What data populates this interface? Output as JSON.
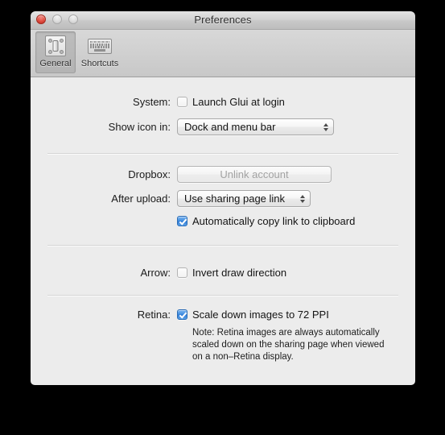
{
  "window": {
    "title": "Preferences",
    "traffic_lights": [
      "close-button",
      "minimize-button",
      "zoom-button"
    ]
  },
  "toolbar": {
    "items": [
      {
        "label": "General",
        "icon": "light-switch-icon",
        "selected": true
      },
      {
        "label": "Shortcuts",
        "icon": "keyboard-icon",
        "selected": false
      }
    ]
  },
  "sections": {
    "system": {
      "label": "System:",
      "launch_at_login": {
        "text": "Launch Glui at login",
        "checked": false
      },
      "show_icon_in": {
        "label": "Show icon in:",
        "value": "Dock and menu bar"
      }
    },
    "dropbox": {
      "label": "Dropbox:",
      "unlink_button": {
        "text": "Unlink account",
        "enabled": false
      },
      "after_upload": {
        "label": "After upload:",
        "value": "Use sharing page link"
      },
      "auto_copy": {
        "text": "Automatically copy link to clipboard",
        "checked": true
      }
    },
    "arrow": {
      "label": "Arrow:",
      "invert": {
        "text": "Invert draw direction",
        "checked": false
      }
    },
    "retina": {
      "label": "Retina:",
      "scale_down": {
        "text": "Scale down images to 72 PPI",
        "checked": true
      },
      "note_lines": [
        "Note: Retina images are always automatically",
        "scaled down on the sharing page when viewed",
        "on a non–Retina display."
      ]
    }
  },
  "colors": {
    "window_background": "#ececec",
    "titlebar_top": "#e4e4e4",
    "titlebar_bottom": "#bdbdbd",
    "toolbar_top": "#d8d8d8",
    "toolbar_bottom": "#c8c8c8",
    "close_button": "#e04b3f",
    "checkbox_checked": "#3f8de0",
    "separator": "#d5d5d5",
    "disabled_text": "#a2a2a2",
    "desktop": "#000000"
  }
}
